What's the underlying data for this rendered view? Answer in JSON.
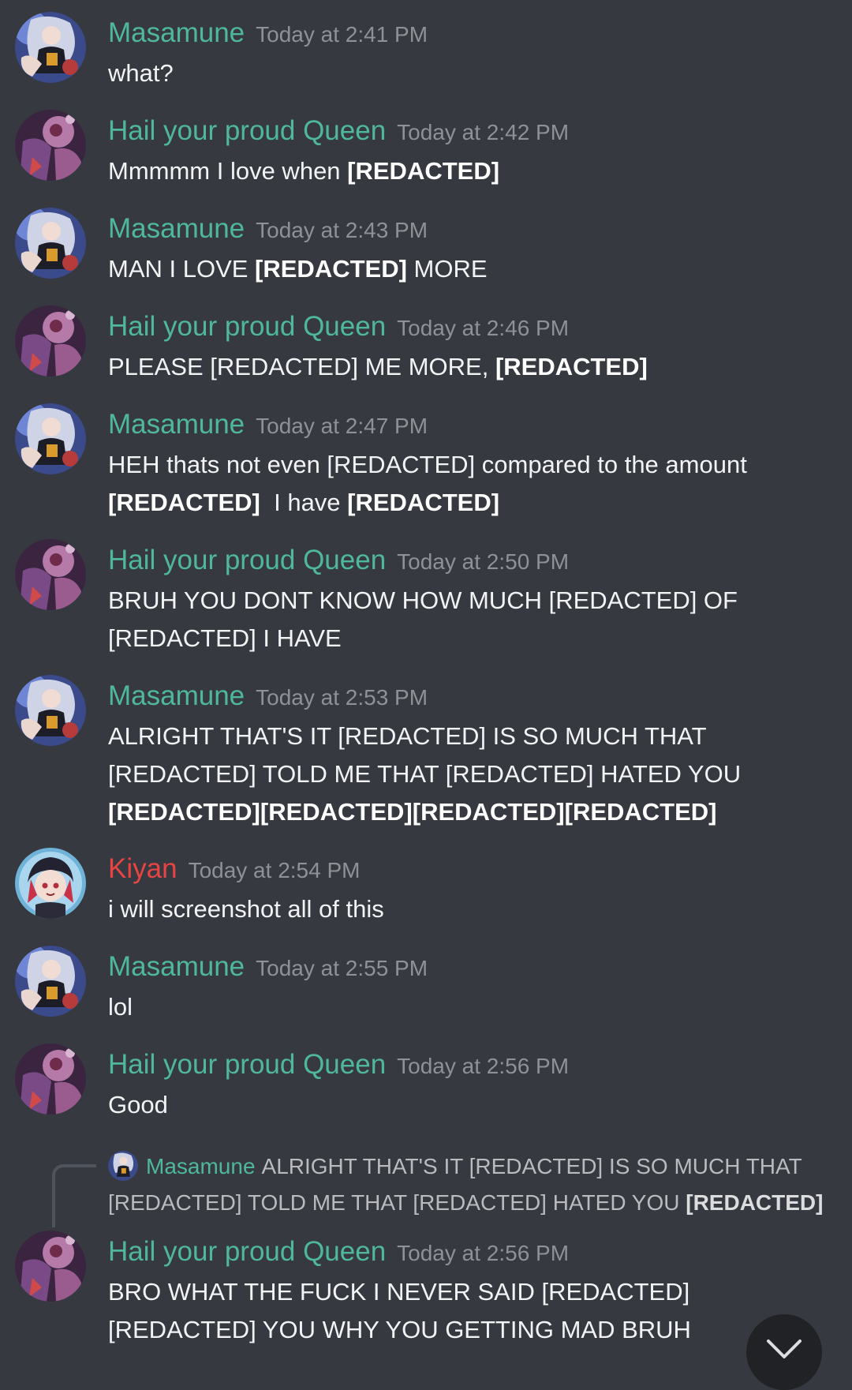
{
  "messages": [
    {
      "author": "Masamune",
      "avatar": "masamune",
      "time": "Today at 2:41 PM",
      "segments": [
        {
          "t": "what?",
          "b": false
        }
      ]
    },
    {
      "author": "Hail your proud Queen",
      "avatar": "queen",
      "time": "Today at 2:42 PM",
      "segments": [
        {
          "t": "Mmmmm I love when ",
          "b": false
        },
        {
          "t": "[REDACTED]",
          "b": true
        }
      ]
    },
    {
      "author": "Masamune",
      "avatar": "masamune",
      "time": "Today at 2:43 PM",
      "segments": [
        {
          "t": "MAN I LOVE ",
          "b": false
        },
        {
          "t": "[REDACTED]",
          "b": true
        },
        {
          "t": " MORE",
          "b": false
        }
      ]
    },
    {
      "author": "Hail your proud Queen",
      "avatar": "queen",
      "time": "Today at 2:46 PM",
      "segments": [
        {
          "t": "PLEASE [REDACTED] ME MORE, ",
          "b": false
        },
        {
          "t": "[REDACTED]",
          "b": true
        }
      ]
    },
    {
      "author": "Masamune",
      "avatar": "masamune",
      "time": "Today at 2:47 PM",
      "segments": [
        {
          "t": "HEH thats not even [REDACTED] compared to the amount ",
          "b": false
        },
        {
          "t": "[REDACTED]",
          "b": true
        },
        {
          "t": "  I have ",
          "b": false
        },
        {
          "t": "[REDACTED]",
          "b": true
        }
      ]
    },
    {
      "author": "Hail your proud Queen",
      "avatar": "queen",
      "time": "Today at 2:50 PM",
      "segments": [
        {
          "t": "BRUH YOU DONT KNOW HOW MUCH [REDACTED] OF [REDACTED] I HAVE",
          "b": false
        }
      ]
    },
    {
      "author": "Masamune",
      "avatar": "masamune",
      "time": "Today at 2:53 PM",
      "segments": [
        {
          "t": "ALRIGHT THAT'S IT [REDACTED] IS SO MUCH THAT [REDACTED] TOLD ME THAT [REDACTED] HATED YOU ",
          "b": false
        },
        {
          "t": "[REDACTED][REDACTED][REDACTED][REDACTED]",
          "b": true
        }
      ]
    },
    {
      "author": "Kiyan",
      "avatar": "kiyan",
      "time": "Today at 2:54 PM",
      "segments": [
        {
          "t": "i will screenshot all of this",
          "b": false
        }
      ]
    },
    {
      "author": "Masamune",
      "avatar": "masamune",
      "time": "Today at 2:55 PM",
      "segments": [
        {
          "t": "lol",
          "b": false
        }
      ]
    },
    {
      "author": "Hail your proud Queen",
      "avatar": "queen",
      "time": "Today at 2:56 PM",
      "segments": [
        {
          "t": "Good",
          "b": false
        }
      ]
    },
    {
      "author": "Hail your proud Queen",
      "avatar": "queen",
      "time": "Today at 2:56 PM",
      "segments": [
        {
          "t": "BRO WHAT THE FUCK I NEVER SAID [REDACTED] [REDACTED] YOU WHY YOU GETTING MAD BRUH",
          "b": false
        }
      ]
    }
  ],
  "reply_preview": {
    "author": "Masamune",
    "text": "ALRIGHT THAT'S IT [REDACTED] IS SO MUCH THAT [REDACTED] TOLD ME THAT [REDACTED] HATED YOU ",
    "bold_tail": "[REDACTED]"
  },
  "colors": {
    "background": "#36393f",
    "author_green": "#4fb89c",
    "author_red": "#e84444",
    "timestamp": "#8e9297",
    "text": "#f2f3f5"
  },
  "icons": {
    "scroll_button": "chevron-down-icon"
  }
}
